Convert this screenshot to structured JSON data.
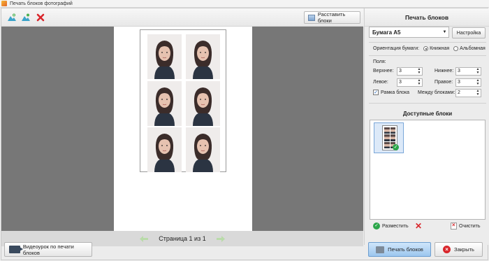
{
  "window": {
    "title": "Печать блоков фотографий"
  },
  "toolbar": {
    "arrange_label": "Расставить блоки",
    "icons": [
      "image-add-icon",
      "image-edit-icon",
      "delete-red-x-icon"
    ]
  },
  "pager": {
    "label": "Страница 1 из 1"
  },
  "bottom": {
    "video_label": "Видеоурок по печати блоков",
    "print_label": "Печать блоков",
    "close_label": "Закрыть"
  },
  "panel": {
    "title": "Печать блоков",
    "paper_value": "Бумага А5",
    "setup_label": "Настройка",
    "orientation_label": "Ориентация бумаги:",
    "orientation_portrait": "Книжная",
    "orientation_landscape": "Альбомная",
    "orientation_selected": "portrait",
    "fields_label": "Поля:",
    "top_label": "Верхнее:",
    "top_value": "3",
    "bottom_label": "Нижнее:",
    "bottom_value": "3",
    "left_label": "Левое:",
    "left_value": "3",
    "right_label": "Правое:",
    "right_value": "3",
    "frame_label": "Рамка блока",
    "frame_checked": true,
    "between_label": "Между блоками:",
    "between_value": "2",
    "available_title": "Доступные блоки",
    "place_label": "Разместить",
    "clear_label": "Очистить"
  },
  "colors": {
    "canvas_bg": "#777777",
    "accent_blue": "#9cc6ee",
    "danger_red": "#d9262b",
    "ok_green": "#2ca64a"
  }
}
